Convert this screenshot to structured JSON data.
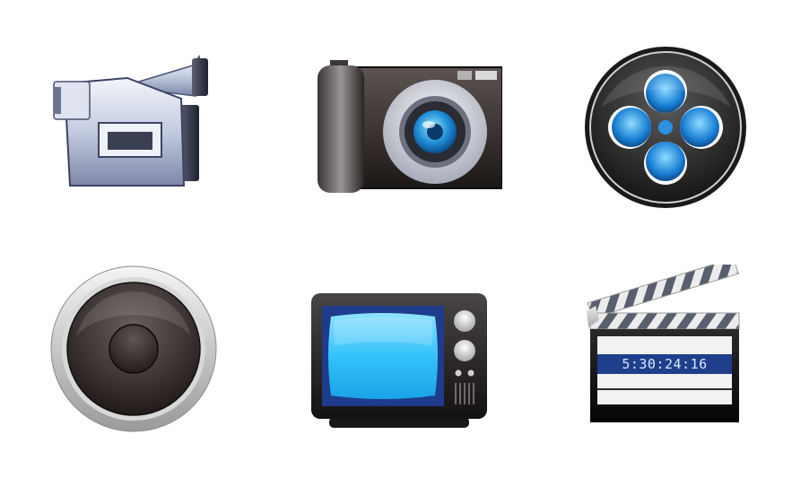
{
  "icons": [
    {
      "name": "camcorder-icon"
    },
    {
      "name": "photo-camera-icon"
    },
    {
      "name": "film-reel-icon"
    },
    {
      "name": "speaker-icon"
    },
    {
      "name": "television-icon"
    },
    {
      "name": "clapperboard-icon"
    }
  ],
  "clapperboard": {
    "timecode": "5:30:24:16"
  }
}
